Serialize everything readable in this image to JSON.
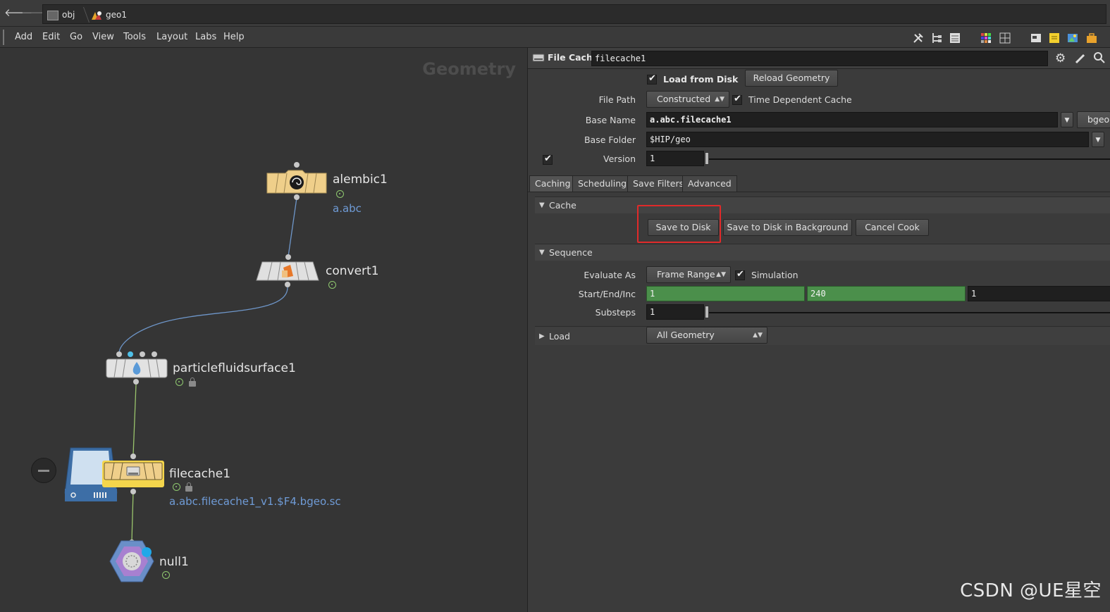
{
  "pathbar": {
    "crumbs": [
      "obj",
      "geo1"
    ]
  },
  "menubar": {
    "items": [
      "Add",
      "Edit",
      "Go",
      "View",
      "Tools",
      "Layout",
      "Labs",
      "Help"
    ]
  },
  "network": {
    "context_title": "Geometry",
    "nodes": [
      {
        "name": "alembic1",
        "sub": "a.abc"
      },
      {
        "name": "convert1",
        "sub": ""
      },
      {
        "name": "particlefluidsurface1",
        "sub": ""
      },
      {
        "name": "filecache1",
        "sub": "a.abc.filecache1_v1.$F4.bgeo.sc"
      },
      {
        "name": "null1",
        "sub": ""
      }
    ]
  },
  "params": {
    "node_type": "File Cache",
    "node_name": "filecache1",
    "load_from_disk_label": "Load from Disk",
    "load_from_disk_checked": true,
    "reload_geometry_label": "Reload Geometry",
    "file_path_label": "File Path",
    "file_path_value": "Constructed",
    "time_dependent_label": "Time Dependent Cache",
    "base_name_label": "Base Name",
    "base_name_value": "a.abc.filecache1",
    "format_value": "bgeo",
    "base_folder_label": "Base Folder",
    "base_folder_value": "$HIP/geo",
    "version_label": "Version",
    "version_value": "1",
    "tabs": [
      "Caching",
      "Scheduling",
      "Save Filters",
      "Advanced"
    ],
    "cache_folder": "Cache",
    "save_to_disk_label": "Save to Disk",
    "save_bg_label": "Save to Disk in Background",
    "cancel_cook_label": "Cancel Cook",
    "sequence_folder": "Sequence",
    "evaluate_as_label": "Evaluate As",
    "evaluate_as_value": "Frame Range",
    "simulation_label": "Simulation",
    "start_end_inc_label": "Start/End/Inc",
    "start_value": "1",
    "end_value": "240",
    "inc_value": "1",
    "substeps_label": "Substeps",
    "substeps_value": "1",
    "load_folder": "Load",
    "load_value": "All Geometry"
  },
  "colors": {
    "highlight": "#e02a2a",
    "range_green": "#4b8f4b",
    "node_selected": "#f4d54c",
    "path_link": "#6f9bd6"
  },
  "watermark": "CSDN @UE星空"
}
